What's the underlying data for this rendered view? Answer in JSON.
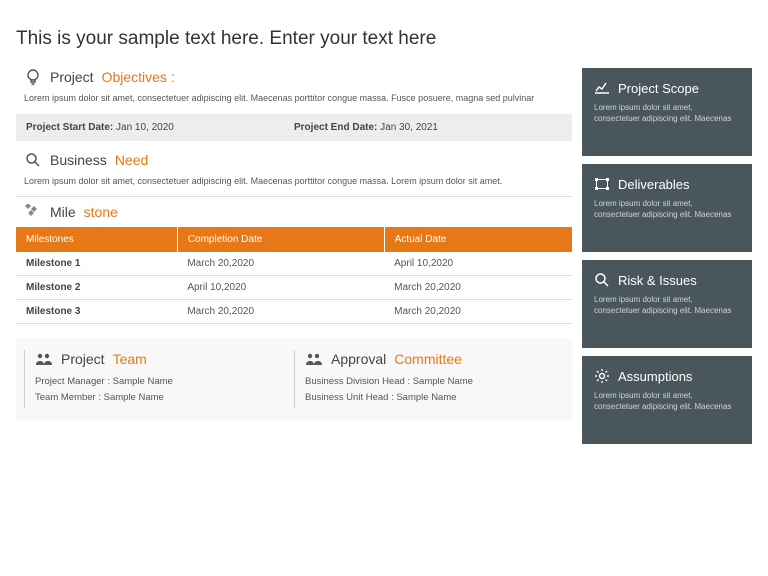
{
  "title": "This is your sample text here. Enter your text here",
  "objectives": {
    "t1": "Project",
    "t2": "Objectives :",
    "body": "Lorem ipsum dolor sit amet, consectetuer adipiscing elit. Maecenas porttitor congue massa. Fusce posuere, magna sed pulvinar"
  },
  "dates": {
    "start_lbl": "Project Start Date:",
    "start_val": " Jan 10, 2020",
    "end_lbl": "Project End Date:",
    "end_val": " Jan 30, 2021"
  },
  "need": {
    "t1": "Business",
    "t2": "Need",
    "body": "Lorem ipsum dolor sit amet, consectetuer adipiscing elit. Maecenas porttitor congue massa. Lorem ipsum dolor sit amet."
  },
  "milestone": {
    "t1": "Mile",
    "t2": "stone",
    "headers": [
      "Milestones",
      "Completion Date",
      "Actual Date"
    ],
    "rows": [
      [
        "Milestone 1",
        "March  20,2020",
        "April 10,2020"
      ],
      [
        "Milestone 2",
        "April 10,2020",
        "March 20,2020"
      ],
      [
        "Milestone 3",
        "March 20,2020",
        "March 20,2020"
      ]
    ]
  },
  "team": {
    "t1": "Project",
    "t2": "Team",
    "rows": [
      "Project Manager : Sample Name",
      "Team Member : Sample Name"
    ]
  },
  "approval": {
    "t1": "Approval",
    "t2": "Committee",
    "rows": [
      "Business Division Head : Sample Name",
      "Business Unit Head : Sample Name"
    ]
  },
  "cards": [
    {
      "title": "Project Scope",
      "body": "Lorem ipsum dolor sit amet, consectetuer adipiscing elit. Maecenas"
    },
    {
      "title": "Deliverables",
      "body": "Lorem ipsum dolor sit amet, consectetuer adipiscing elit. Maecenas"
    },
    {
      "title": "Risk & Issues",
      "body": "Lorem ipsum dolor sit amet, consectetuer adipiscing elit. Maecenas"
    },
    {
      "title": "Assumptions",
      "body": "Lorem ipsum dolor sit amet, consectetuer adipiscing elit. Maecenas"
    }
  ]
}
